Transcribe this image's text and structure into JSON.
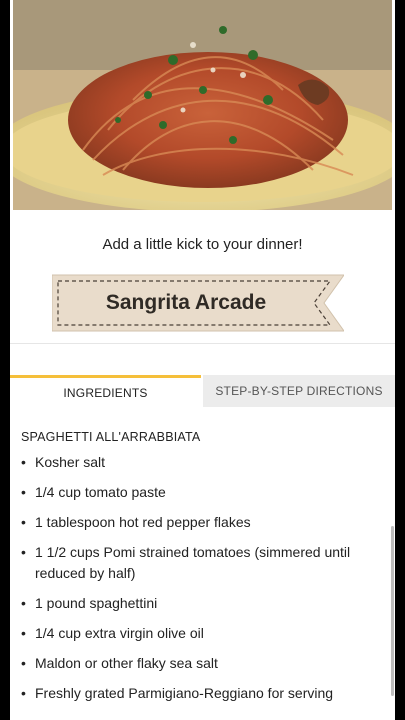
{
  "hero": {
    "image_description": ""
  },
  "tagline": "Add a little kick to your dinner!",
  "banner": {
    "title": "Sangrita Arcade"
  },
  "tabs": {
    "ingredients": "INGREDIENTS",
    "directions": "STEP-BY-STEP DIRECTIONS"
  },
  "recipe": {
    "title": "SPAGHETTI ALL'ARRABBIATA",
    "bullet": "•",
    "ingredients": [
      "Kosher salt",
      "1/4 cup tomato paste",
      "1 tablespoon hot red pepper flakes",
      "1 1/2 cups Pomi strained tomatoes (simmered until reduced by half)",
      "1 pound spaghettini",
      "1/4 cup extra virgin olive oil",
      "Maldon or other flaky sea salt",
      "Freshly grated Parmigiano-Reggiano for serving"
    ]
  },
  "colors": {
    "tab_accent": "#f5bf3a",
    "inactive_tab": "#ececec",
    "banner_fill": "#e9dccb"
  }
}
